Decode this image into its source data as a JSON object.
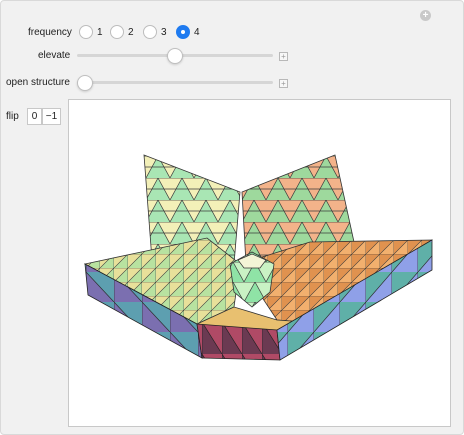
{
  "controls": {
    "frequency": {
      "label": "frequency",
      "options": [
        "1",
        "2",
        "3",
        "4"
      ],
      "selected": "4"
    },
    "elevate": {
      "label": "elevate",
      "value_fraction": 0.5
    },
    "open_structure": {
      "label": "open structure",
      "value_fraction": 0.0
    },
    "flip": {
      "label": "flip",
      "buttons": [
        "0",
        "−1"
      ]
    }
  },
  "icons": {
    "corner": "plus-circle-icon",
    "slider_expand": "plus-square-icon"
  },
  "colors": {
    "accent": "#1f7bf0"
  }
}
